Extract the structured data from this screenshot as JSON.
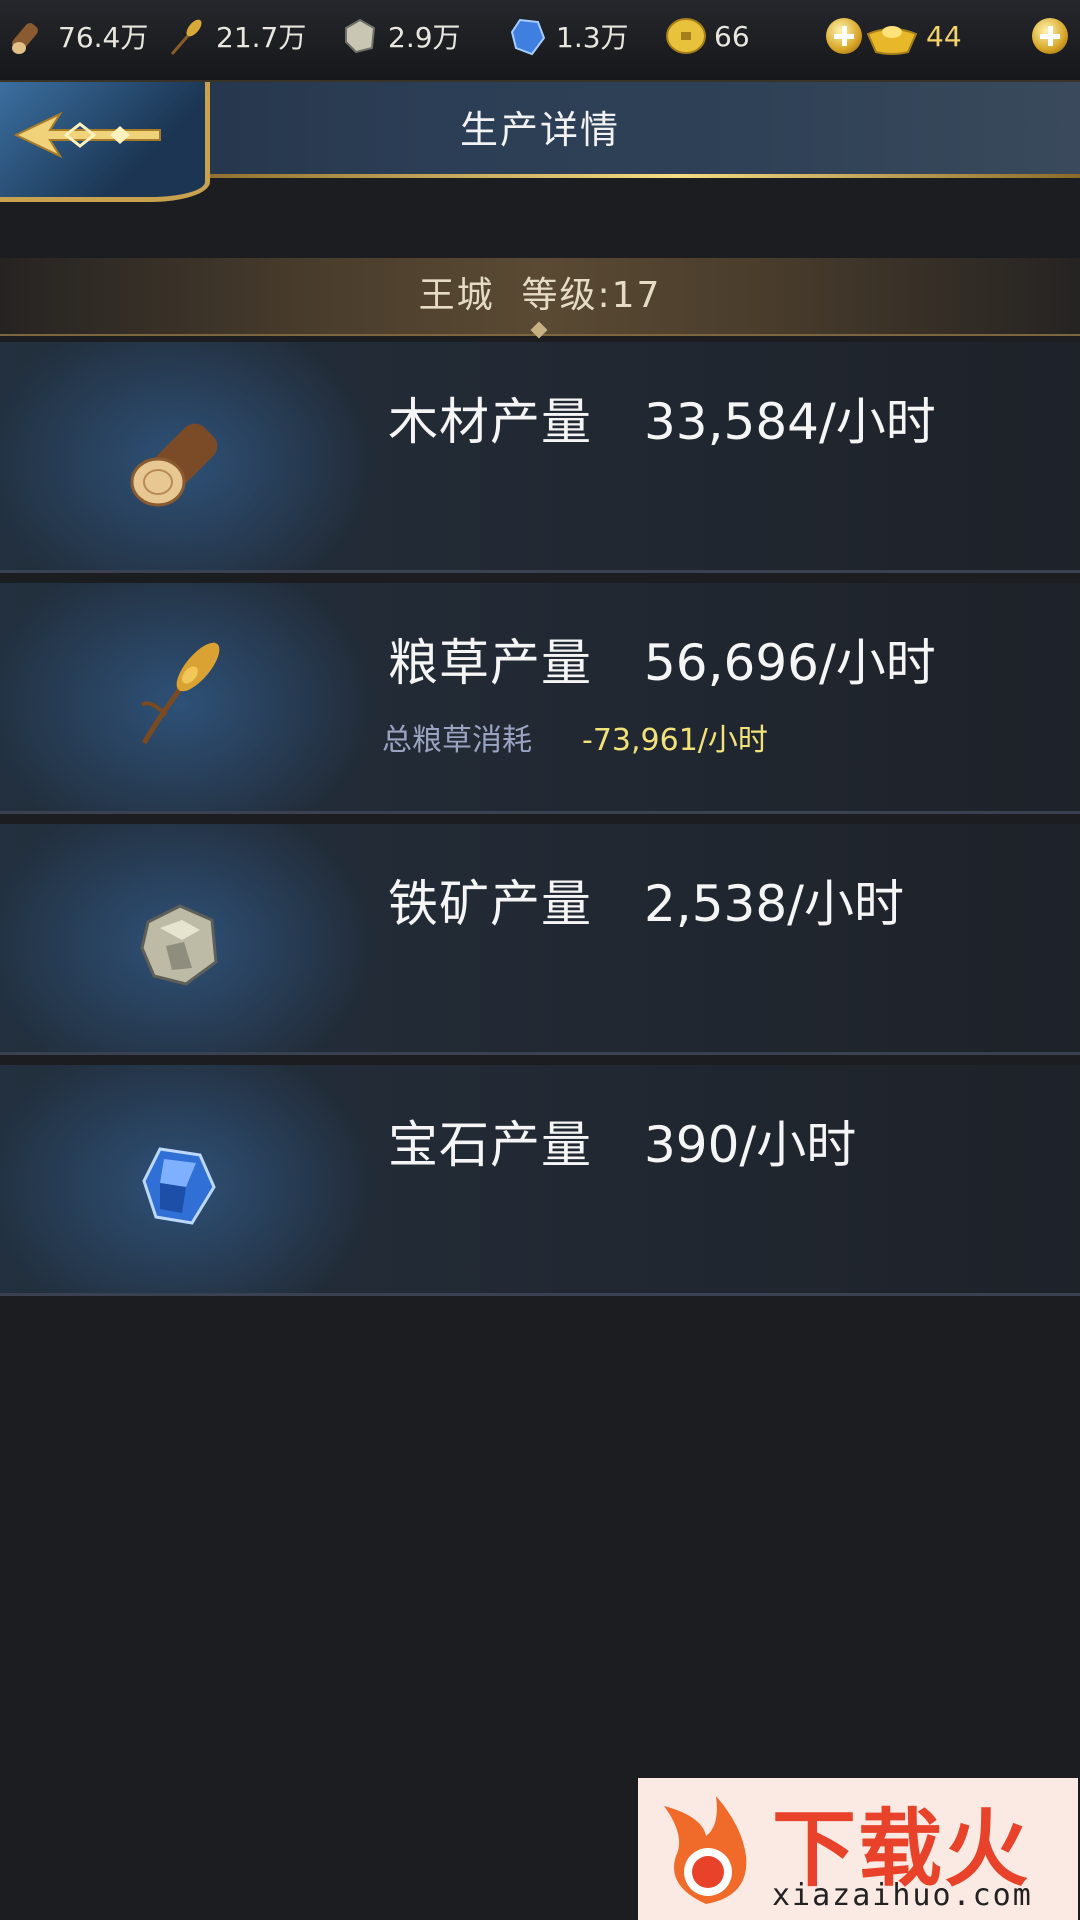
{
  "resources": [
    {
      "icon": "wood-icon",
      "value": "76.4万"
    },
    {
      "icon": "grain-icon",
      "value": "21.7万"
    },
    {
      "icon": "iron-ore-icon",
      "value": "2.9万"
    },
    {
      "icon": "gem-icon",
      "value": "1.3万"
    },
    {
      "icon": "coin-icon",
      "value": "66"
    }
  ],
  "ingot": {
    "icon": "gold-ingot-icon",
    "value": "44"
  },
  "header": {
    "title": "生产详情"
  },
  "banner": {
    "text": "王城  等级:17"
  },
  "rows": [
    {
      "icon": "wood-log-icon",
      "title": "木材产量",
      "amount": "33,584/小时"
    },
    {
      "icon": "wheat-icon",
      "title": "粮草产量",
      "amount": "56,696/小时",
      "consume_label": "总粮草消耗",
      "consume_value": "-73,961/小时"
    },
    {
      "icon": "iron-ore-icon",
      "title": "铁矿产量",
      "amount": "2,538/小时"
    },
    {
      "icon": "gem-icon",
      "title": "宝石产量",
      "amount": "390/小时"
    }
  ],
  "watermark": {
    "text": "下载火",
    "url": "xiazaihuo.com"
  }
}
